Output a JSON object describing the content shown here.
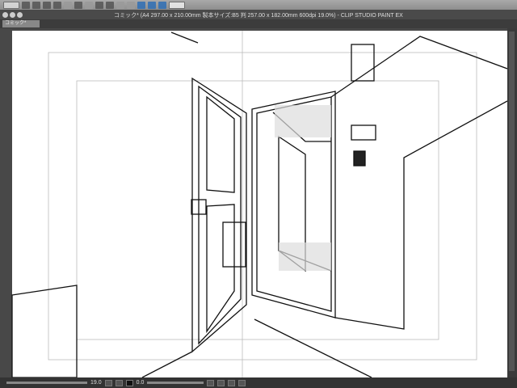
{
  "window": {
    "title": "コミック* (A4 297.00 x 210.00mm 製本サイズ:B5 判 257.00 x 182.00mm 600dpi 19.0%)  - CLIP STUDIO PAINT EX"
  },
  "tabs": [
    {
      "label": "コミック*"
    }
  ],
  "status": {
    "zoom": "19.0",
    "rotation": "0.0"
  },
  "toolbar": {
    "icons": [
      "clip-studio-menu",
      "new",
      "open",
      "save",
      "undo",
      "redo",
      "transform",
      "select",
      "fill",
      "crop",
      "snap-ruler",
      "snap-special",
      "snap-grid",
      "help"
    ]
  }
}
